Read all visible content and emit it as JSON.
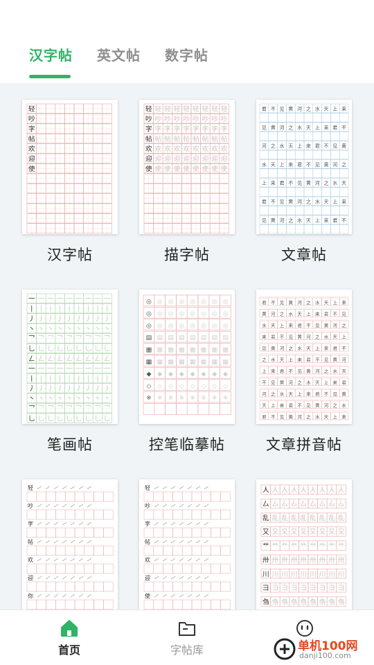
{
  "tabs": [
    {
      "label": "汉字帖",
      "active": true
    },
    {
      "label": "英文帖",
      "active": false
    },
    {
      "label": "数字帖",
      "active": false
    }
  ],
  "accent_color": "#2fb368",
  "cards": [
    {
      "label": "汉字帖",
      "style": "red-grid-chars",
      "sample_chars": [
        "轻",
        "吵",
        "字",
        "帖",
        "欢",
        "迎",
        "使"
      ]
    },
    {
      "label": "描字帖",
      "style": "red-grid-trace",
      "sample_chars": [
        "轻",
        "吵",
        "字",
        "帖",
        "欢",
        "迎",
        "使"
      ]
    },
    {
      "label": "文章帖",
      "style": "blue-grid-article",
      "sample_chars": [
        "君",
        "不",
        "见",
        "黄",
        "河",
        "之",
        "水",
        "天",
        "上",
        "来"
      ]
    },
    {
      "label": "笔画帖",
      "style": "green-grid-strokes",
      "sample_chars": [
        "一",
        "丨",
        "丿",
        "丶",
        "乛",
        "乚",
        "ㄥ"
      ]
    },
    {
      "label": "控笔临摹帖",
      "style": "red-grid-pen-control",
      "sample_chars": []
    },
    {
      "label": "文章拼音帖",
      "style": "red-grid-pinyin",
      "sample_chars": [
        "君",
        "不",
        "见",
        "黄",
        "河",
        "之",
        "水",
        "天",
        "上",
        "来"
      ]
    },
    {
      "label": "",
      "style": "stroke-order-1",
      "sample_chars": [
        "轻",
        "吵",
        "字",
        "帖",
        "欢",
        "迎",
        "你"
      ]
    },
    {
      "label": "",
      "style": "stroke-order-2",
      "sample_chars": [
        "轻",
        "吵",
        "字",
        "帖",
        "欢",
        "迎",
        "使"
      ]
    },
    {
      "label": "",
      "style": "radical-practice",
      "sample_chars": [
        "人",
        "厶",
        "乱",
        "又",
        "艹",
        "卅",
        "川",
        "彐",
        "刍"
      ]
    }
  ],
  "bottom_nav": [
    {
      "label": "首页",
      "icon": "home-icon",
      "active": true
    },
    {
      "label": "字帖库",
      "icon": "folder-icon",
      "active": false
    },
    {
      "label": "",
      "icon": "face-icon",
      "active": false
    }
  ],
  "watermark": {
    "text": "单机100网",
    "url": "danji100.com"
  }
}
